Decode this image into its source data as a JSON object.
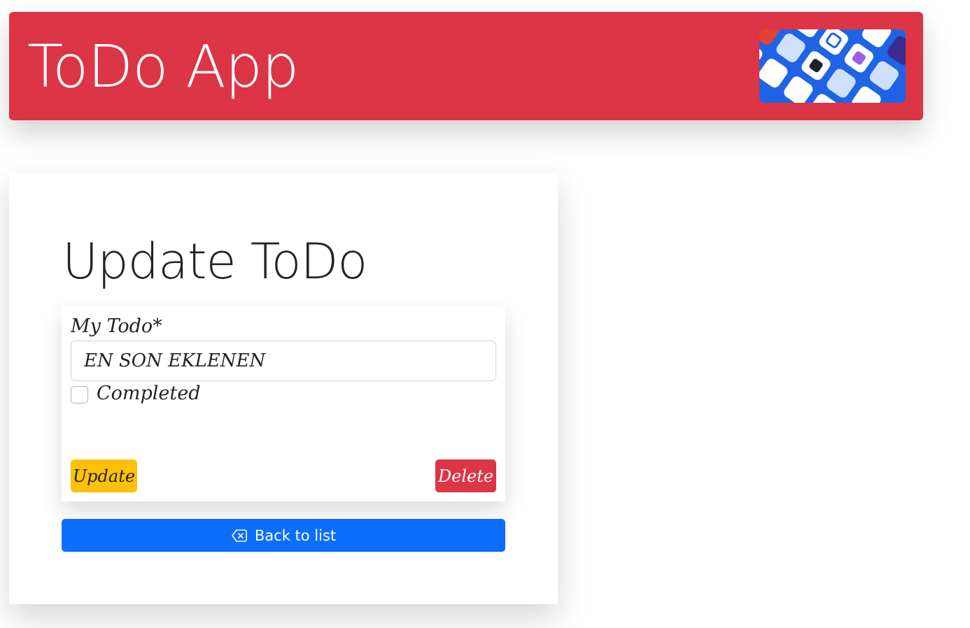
{
  "colors": {
    "navbar_bg": "#dc3545",
    "update_button_bg": "#ffc107",
    "delete_button_bg": "#dc3545",
    "back_button_bg": "#0d6efd"
  },
  "header": {
    "brand": "ToDo App",
    "logo_icon": "todo-apps-collage-icon"
  },
  "main": {
    "title": "Update ToDo",
    "form": {
      "todo_label": "My Todo*",
      "todo_value": "EN SON EKLENEN",
      "completed_label": "Completed",
      "completed_checked": false,
      "update_label": "Update",
      "delete_label": "Delete"
    },
    "back_label": "Back to list",
    "back_icon": "backspace-icon"
  }
}
